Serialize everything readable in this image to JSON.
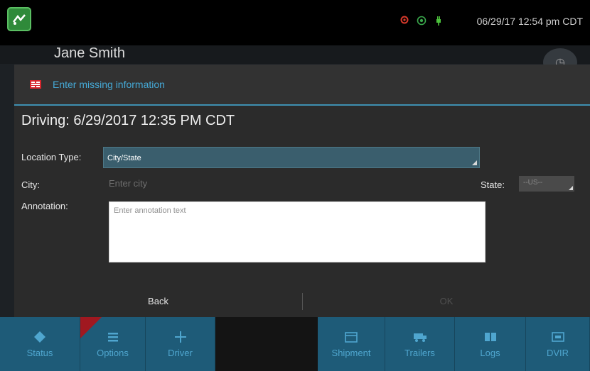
{
  "status_bar": {
    "time": "06/29/17 12:54 pm CDT",
    "app_icon": "app-logo-icon",
    "icons": [
      "location-icon",
      "signal-icon",
      "power-plug-icon"
    ],
    "colors": {
      "location": "#d93a2b",
      "signal": "#3aa84c",
      "power": "#4cc23c"
    }
  },
  "header": {
    "driver_name": "Jane Smith",
    "clock_icon": "clock-icon"
  },
  "dialog": {
    "title": "Enter missing information",
    "driving_line": "Driving: 6/29/2017 12:35 PM CDT",
    "location_type_label": "Location Type:",
    "location_type_value": "City/State",
    "city_label": "City:",
    "city_placeholder": "Enter city",
    "state_label": "State:",
    "state_value": "--US--",
    "annotation_label": "Annotation:",
    "annotation_placeholder": "Enter annotation text",
    "back_label": "Back",
    "ok_label": "OK"
  },
  "nav": {
    "items": [
      {
        "label": "Status",
        "icon": "diamond-icon"
      },
      {
        "label": "Options",
        "icon": "list-icon"
      },
      {
        "label": "Driver",
        "icon": "plus-icon"
      },
      {
        "label": "Shipment",
        "icon": "box-icon"
      },
      {
        "label": "Trailers",
        "icon": "truck-icon"
      },
      {
        "label": "Logs",
        "icon": "book-icon"
      },
      {
        "label": "DVIR",
        "icon": "dvir-icon"
      }
    ]
  },
  "colors": {
    "accent": "#3e8fb1",
    "nav_bg": "#1e5b78",
    "nav_text": "#4fa6cf",
    "warning": "#d8262d"
  }
}
